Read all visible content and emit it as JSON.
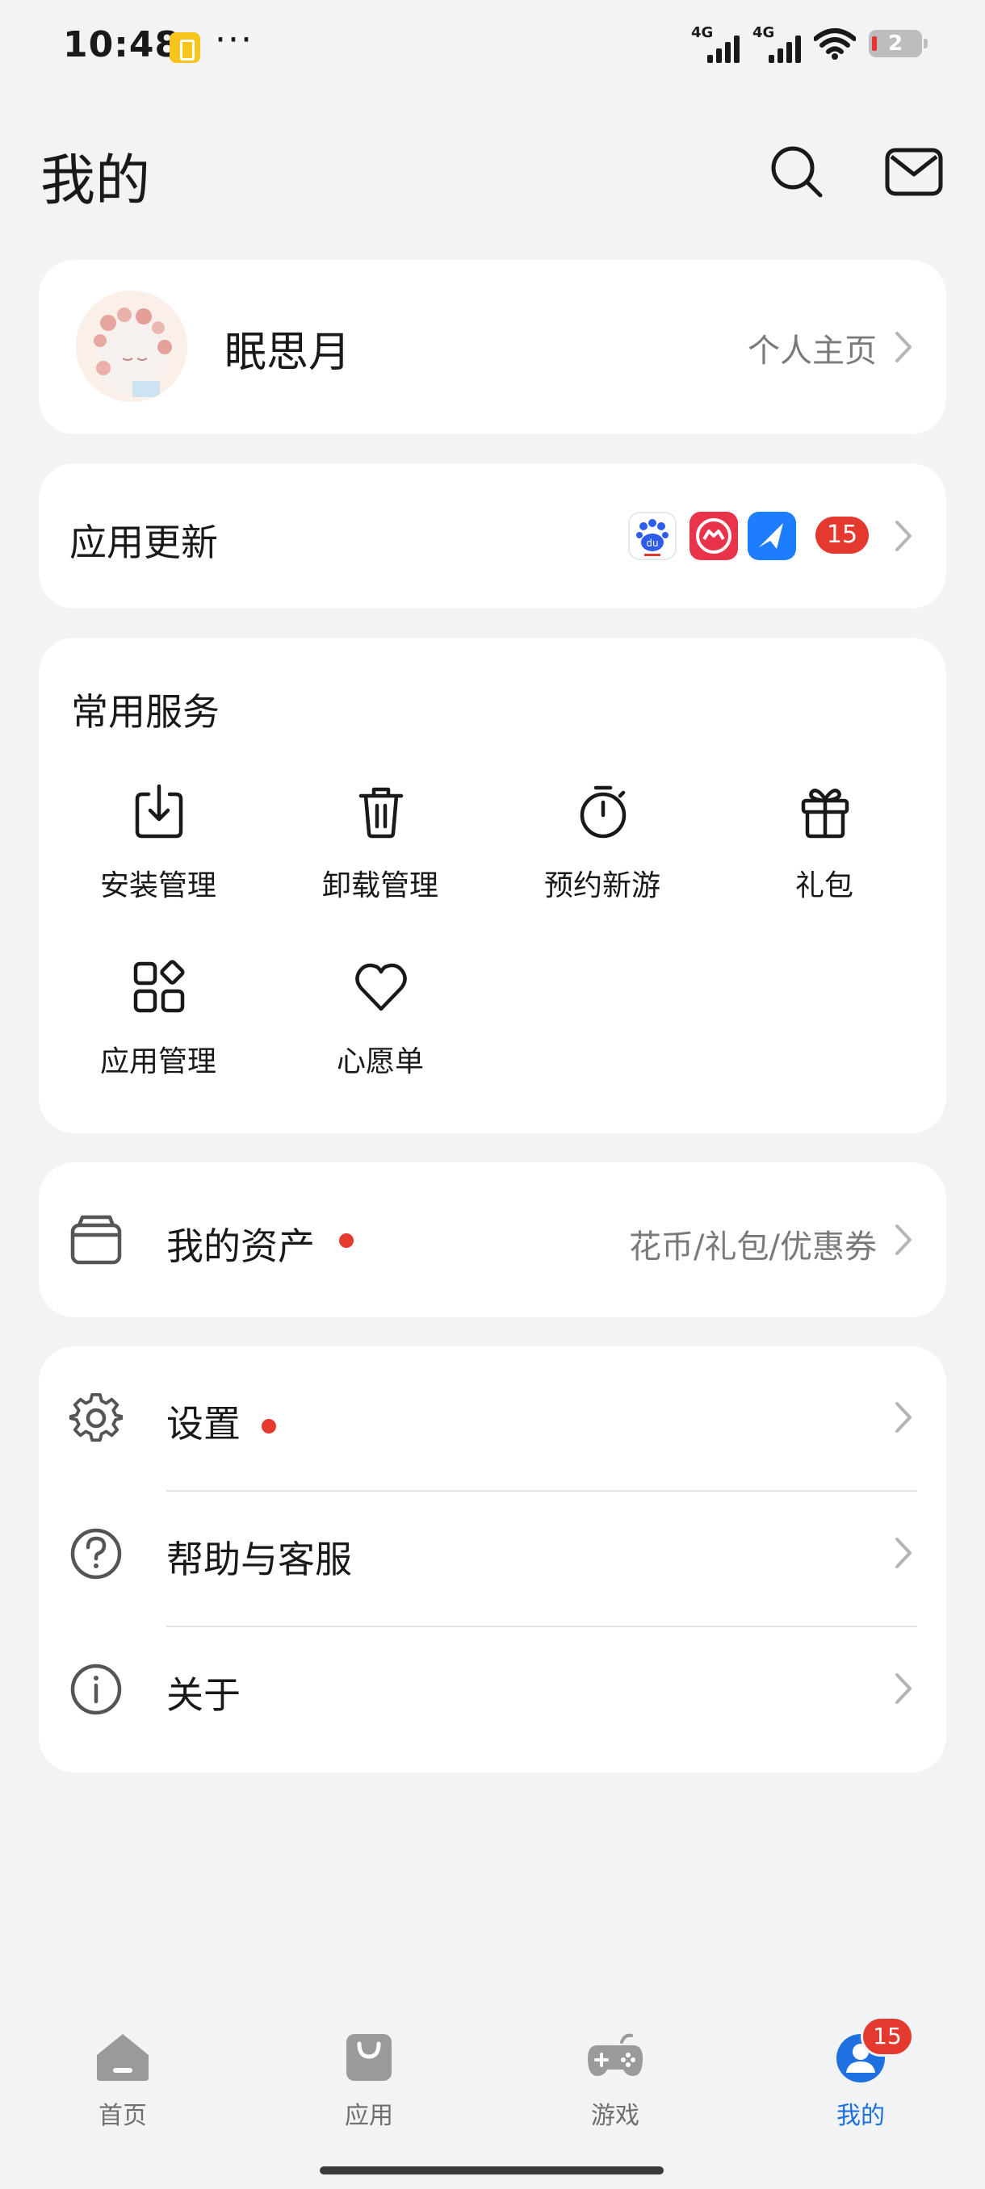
{
  "status_bar": {
    "time": "10:48",
    "more": "···",
    "signal_1": "4G",
    "signal_2": "4G",
    "battery": "2"
  },
  "header": {
    "title": "我的",
    "icons": [
      "search-icon",
      "mail-icon"
    ]
  },
  "profile": {
    "name": "眠思月",
    "link_label": "个人主页"
  },
  "updates": {
    "title": "应用更新",
    "count": "15"
  },
  "services": {
    "title": "常用服务",
    "items": [
      {
        "label": "安装管理",
        "icon": "install-icon"
      },
      {
        "label": "卸载管理",
        "icon": "trash-icon"
      },
      {
        "label": "预约新游",
        "icon": "stopwatch-icon"
      },
      {
        "label": "礼包",
        "icon": "gift-icon"
      },
      {
        "label": "应用管理",
        "icon": "apps-grid-icon"
      },
      {
        "label": "心愿单",
        "icon": "heart-icon"
      }
    ]
  },
  "assets": {
    "label": "我的资产",
    "hint": "花币/礼包/优惠券"
  },
  "menu": [
    {
      "label": "设置",
      "icon": "gear-icon"
    },
    {
      "label": "帮助与客服",
      "icon": "help-icon"
    },
    {
      "label": "关于",
      "icon": "info-icon"
    }
  ],
  "bottom_nav": {
    "items": [
      {
        "label": "首页",
        "icon": "home-icon"
      },
      {
        "label": "应用",
        "icon": "shopping-bag-icon"
      },
      {
        "label": "游戏",
        "icon": "gamepad-icon"
      },
      {
        "label": "我的",
        "icon": "person-icon"
      }
    ],
    "badge": "15",
    "active_color": "#1e6fe0"
  },
  "colors": {
    "background": "#f1f3f5",
    "badge_red": "#e4392f",
    "accent_blue": "#1e6fe0"
  }
}
